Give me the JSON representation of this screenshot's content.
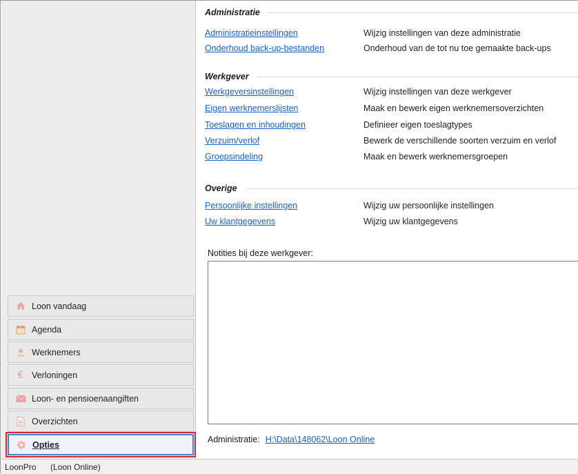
{
  "sidebar": {
    "items": [
      {
        "label": "Loon vandaag",
        "icon": "home-icon"
      },
      {
        "label": "Agenda",
        "icon": "calendar-icon"
      },
      {
        "label": "Werknemers",
        "icon": "person-icon"
      },
      {
        "label": "Verloningen",
        "icon": "euro-icon"
      },
      {
        "label": "Loon- en pensioenaangiften",
        "icon": "envelope-icon"
      },
      {
        "label": "Overzichten",
        "icon": "document-icon"
      },
      {
        "label": "Opties",
        "icon": "gear-icon",
        "active": true
      }
    ]
  },
  "main": {
    "groups": [
      {
        "title": "Administratie",
        "rows": [
          {
            "link": "Administratieinstellingen",
            "desc": "Wijzig instellingen van deze administratie"
          },
          {
            "link": "Onderhoud back-up-bestanden",
            "desc": "Onderhoud van de tot nu toe gemaakte back-ups"
          }
        ]
      },
      {
        "title": "Werkgever",
        "rows": [
          {
            "link": "Werkgeversinstellingen",
            "desc": "Wijzig instellingen van deze werkgever"
          },
          {
            "link": "Eigen werknemerslijsten",
            "desc": "Maak en bewerk eigen werknemersoverzichten"
          },
          {
            "link": "Toeslagen en inhoudingen",
            "desc": "Definieer eigen toeslagtypes"
          },
          {
            "link": "Verzuim/verlof",
            "desc": "Bewerk de verschillende soorten verzuim en verlof"
          },
          {
            "link": "Groepsindeling",
            "desc": "Maak en bewerk werknemersgroepen"
          }
        ]
      },
      {
        "title": "Overige",
        "rows": [
          {
            "link": "Persoonlijke instellingen",
            "desc": "Wijzig uw persoonlijke instellingen"
          },
          {
            "link": "Uw klantgegevens",
            "desc": "Wijzig uw klantgegevens"
          }
        ]
      }
    ],
    "notes_label": "Notities bij deze werkgever:",
    "notes_value": "",
    "admin_label": "Administratie:",
    "admin_path": "H:\\Data\\148062\\Loon Online"
  },
  "statusbar": {
    "app": "LoonPro",
    "context": "(Loon Online)"
  },
  "colors": {
    "link": "#1a5fd6",
    "active_border": "#3e84dc",
    "highlight": "#d8262e"
  }
}
